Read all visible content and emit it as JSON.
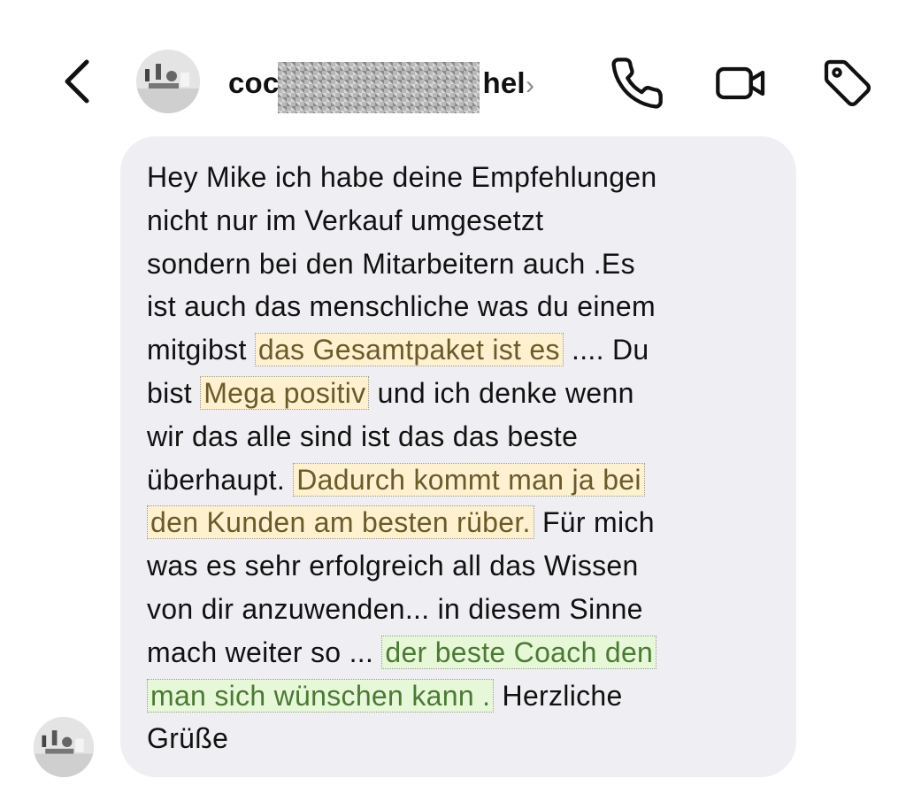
{
  "header": {
    "contact_name_start": "coc",
    "contact_name_end": "hel",
    "chevron": "›",
    "icons": [
      "back-chevron-icon",
      "phone-icon",
      "video-camera-icon",
      "tag-icon"
    ]
  },
  "message": {
    "line1": "Hey Mike ich habe deine Empfehlungen",
    "line2": "nicht nur im Verkauf umgesetzt",
    "line3": "sondern bei den Mitarbeitern auch .Es",
    "line4": "ist auch das menschliche was du einem",
    "line5_pre": "mitgibst",
    "line5_hl": "das Gesamtpaket ist es",
    "line5_post": ".... Du",
    "line6_pre": "bist",
    "line6_hl": "Mega positiv",
    "line6_post": "und ich denke wenn",
    "line7": "wir das alle sind ist das das beste",
    "line8_pre": "überhaupt.",
    "line8_hl": "Dadurch kommt man ja bei",
    "line9_hl": "den Kunden am besten rüber.",
    "line9_post": "Für mich",
    "line10": "was es sehr erfolgreich all das Wissen",
    "line11": "von dir anzuwenden... in diesem Sinne",
    "line12_pre": "mach weiter so ...",
    "line12_hl": "der beste Coach den",
    "line13_hl": "man sich wünschen kann",
    "line13_dot": ".",
    "line13_post": "Herzliche",
    "line14": "Grüße"
  },
  "colors": {
    "bubble": "#efeff3",
    "highlight_yellow": "#fdf1cf",
    "highlight_green": "#e7f8d8"
  }
}
